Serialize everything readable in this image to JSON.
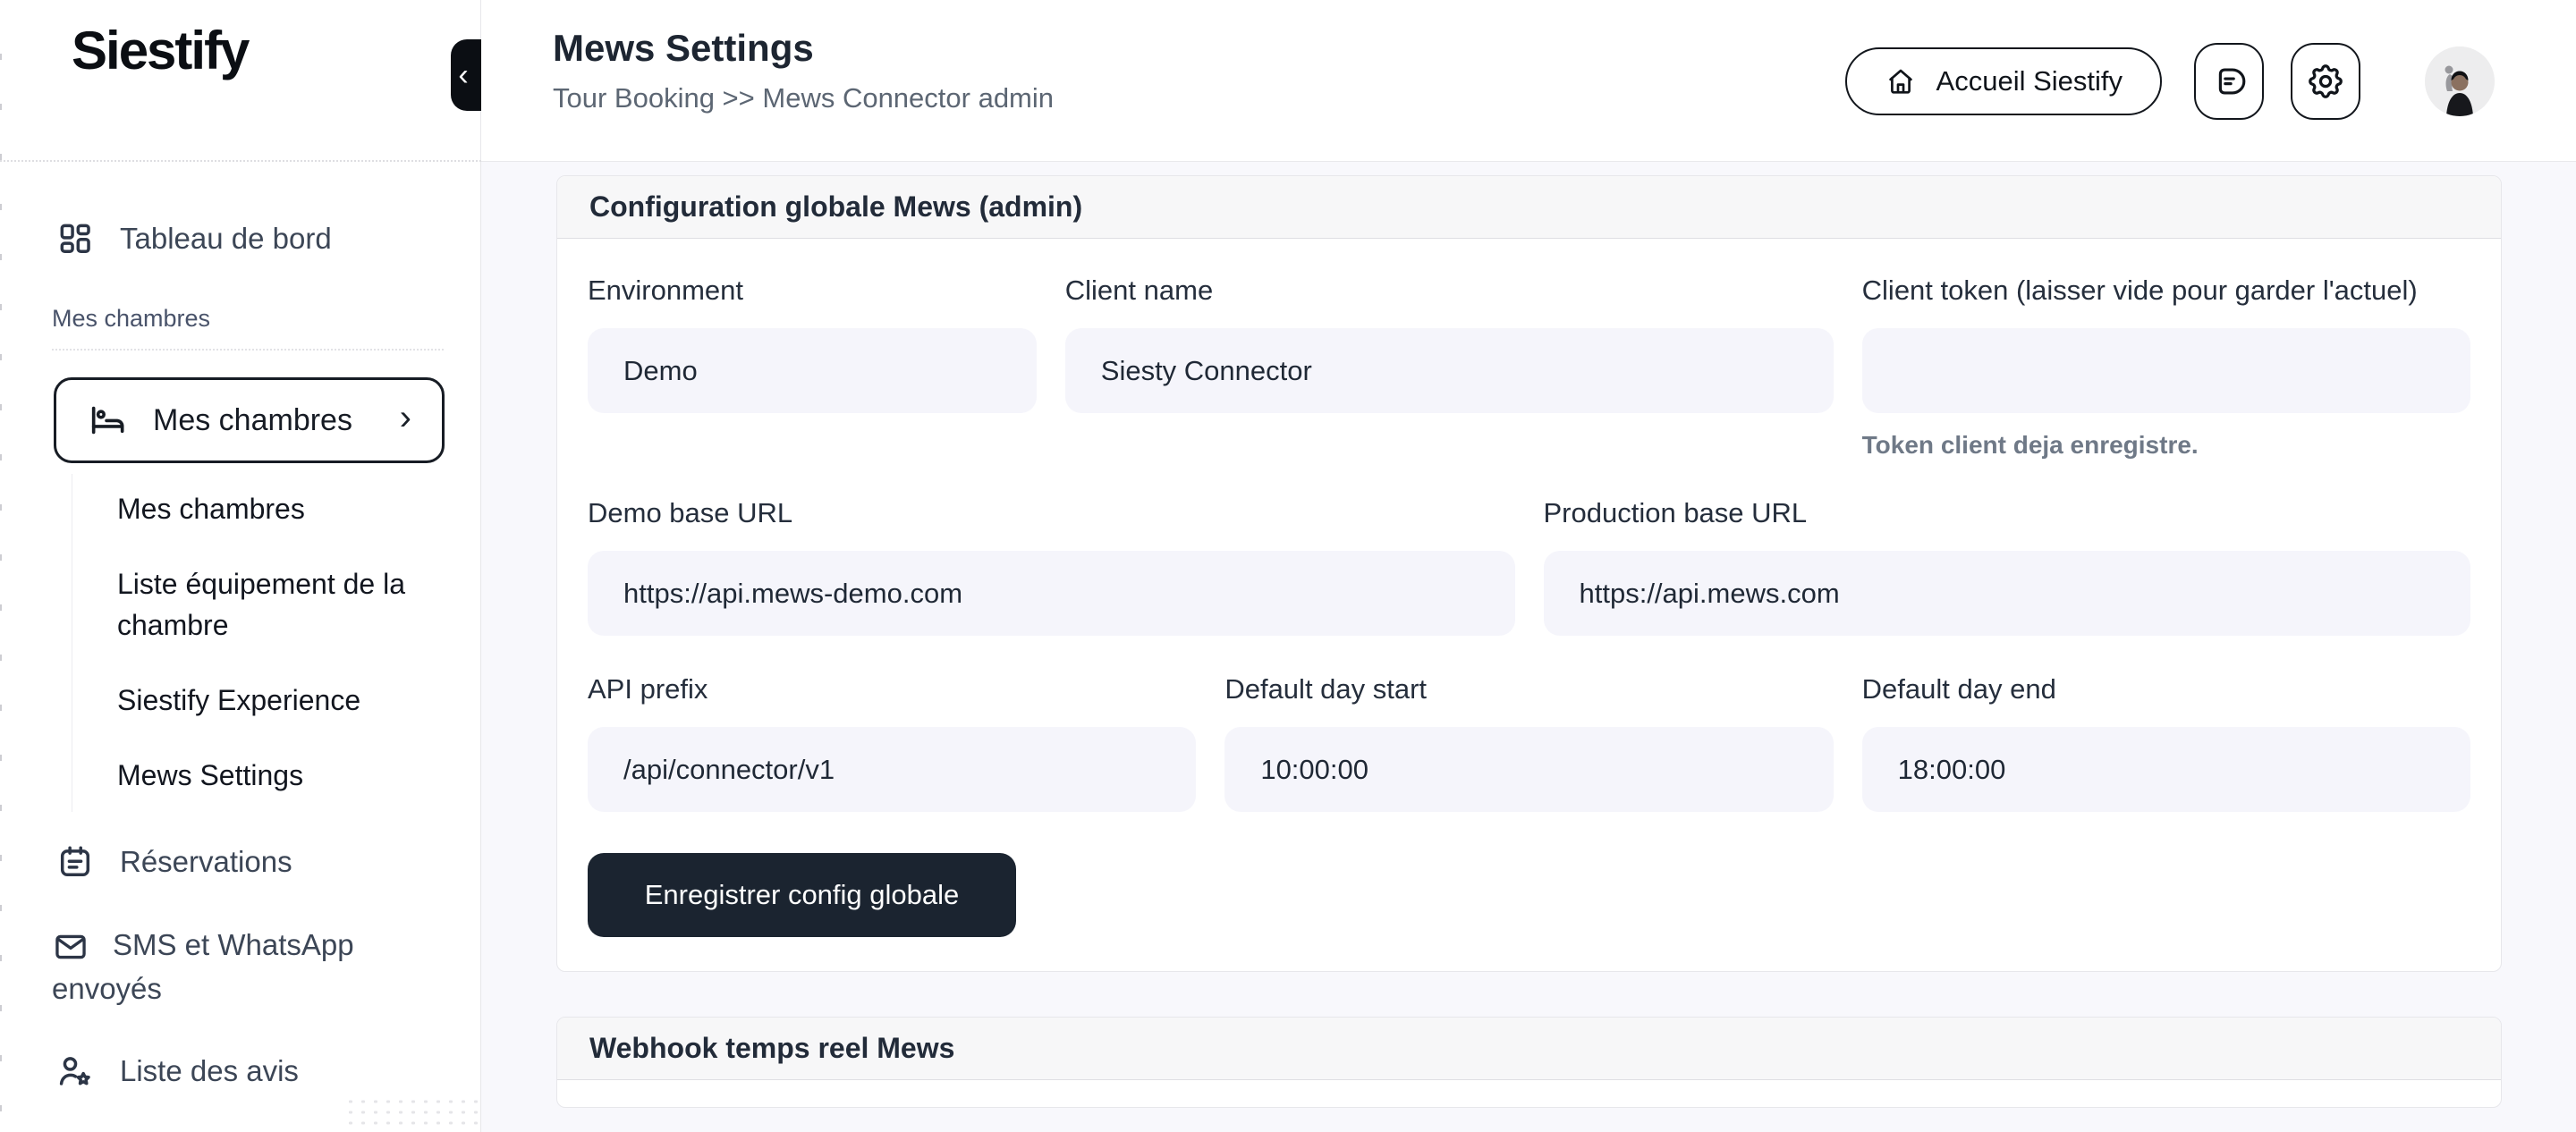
{
  "app": {
    "logo": "Siestify",
    "collapse_chevron": "‹"
  },
  "sidebar": {
    "dashboard_item": {
      "label": "Tableau de bord",
      "icon": "dashboard-icon"
    },
    "section_label": "Mes chambres",
    "active_item": {
      "label": "Mes chambres",
      "icon": "bed-icon",
      "chevron": "›"
    },
    "submenu_items": [
      "Mes chambres",
      "Liste équipement de la chambre",
      "Siestify Experience",
      "Mews Settings"
    ],
    "reservations_item": {
      "label": "Réservations",
      "icon": "calendar-icon"
    },
    "sms_item": {
      "label": "SMS et WhatsApp envoyés",
      "icon": "mail-icon"
    },
    "avis_item": {
      "label": "Liste des avis",
      "icon": "user-star-icon"
    }
  },
  "header": {
    "title": "Mews Settings",
    "breadcrumb": "Tour Booking >> Mews Connector admin",
    "home_button_label": "Accueil Siestify",
    "icon_buttons": [
      "chat-icon",
      "gear-icon"
    ],
    "avatar": "user-avatar"
  },
  "global_config_card": {
    "title": "Configuration globale Mews (admin)",
    "fields": {
      "environment": {
        "label": "Environment",
        "value": "Demo"
      },
      "client_name": {
        "label": "Client name",
        "value": "Siesty Connector"
      },
      "client_token": {
        "label": "Client token (laisser vide pour garder l'actuel)",
        "value": "",
        "helper": "Token client deja enregistre."
      },
      "demo_base_url": {
        "label": "Demo base URL",
        "value": "https://api.mews-demo.com"
      },
      "production_base_url": {
        "label": "Production base URL",
        "value": "https://api.mews.com"
      },
      "api_prefix": {
        "label": "API prefix",
        "value": "/api/connector/v1"
      },
      "default_day_start": {
        "label": "Default day start",
        "value": "10:00:00"
      },
      "default_day_end": {
        "label": "Default day end",
        "value": "18:00:00"
      }
    },
    "save_button_label": "Enregistrer config globale"
  },
  "webhook_card": {
    "title": "Webhook temps reel Mews"
  },
  "colors": {
    "accent_dark": "#1b2430",
    "main_bg": "#f8f8fc",
    "input_bg": "#f5f5fb",
    "card_header_bg": "#f7f7f8",
    "text_dark": "#1f2733",
    "text_gray": "#5c6673",
    "helper_gray": "#6f7987"
  }
}
